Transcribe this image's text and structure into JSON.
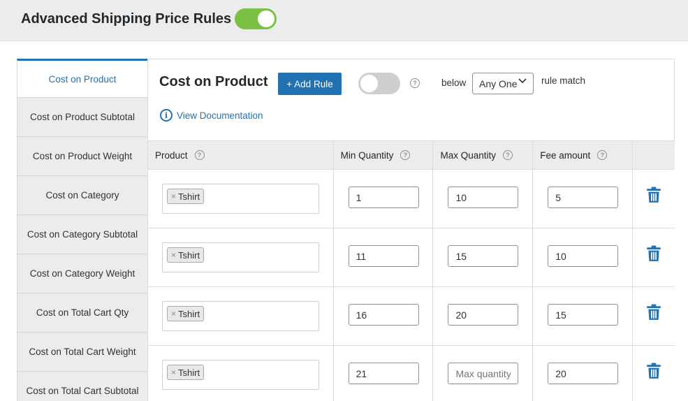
{
  "header": {
    "title": "Advanced Shipping Price Rules",
    "toggle_state": "on"
  },
  "sidebar": {
    "items": [
      {
        "label": "Cost on Product",
        "active": true
      },
      {
        "label": "Cost on Product Subtotal"
      },
      {
        "label": "Cost on Product Weight"
      },
      {
        "label": "Cost on Category"
      },
      {
        "label": "Cost on Category Subtotal"
      },
      {
        "label": "Cost on Category Weight"
      },
      {
        "label": "Cost on Total Cart Qty"
      },
      {
        "label": "Cost on Total Cart Weight"
      },
      {
        "label": "Cost on Total Cart Subtotal"
      }
    ]
  },
  "panel": {
    "title": "Cost on Product",
    "add_rule_label": "+ Add Rule",
    "toggle_state": "off",
    "below_label": "below",
    "match_select": "Any One",
    "rule_match_label": "rule match",
    "doc_link": "View Documentation"
  },
  "table": {
    "columns": [
      "Product",
      "Min Quantity",
      "Max Quantity",
      "Fee amount"
    ],
    "rows": [
      {
        "product_tag": "Tshirt",
        "min": "1",
        "max": "10",
        "fee": "5"
      },
      {
        "product_tag": "Tshirt",
        "min": "11",
        "max": "15",
        "fee": "10"
      },
      {
        "product_tag": "Tshirt",
        "min": "16",
        "max": "20",
        "fee": "15"
      },
      {
        "product_tag": "Tshirt",
        "min": "21",
        "max": "",
        "fee": "20"
      }
    ],
    "max_placeholder": "Max quantity"
  },
  "icons": {
    "help": "question-circle-icon",
    "info": "info-circle-icon",
    "delete": "trash-icon",
    "chevron": "chevron-down-icon"
  },
  "colors": {
    "accent": "#2271b1",
    "toggle_on": "#7ac143",
    "toggle_off": "#cfcfcf"
  }
}
